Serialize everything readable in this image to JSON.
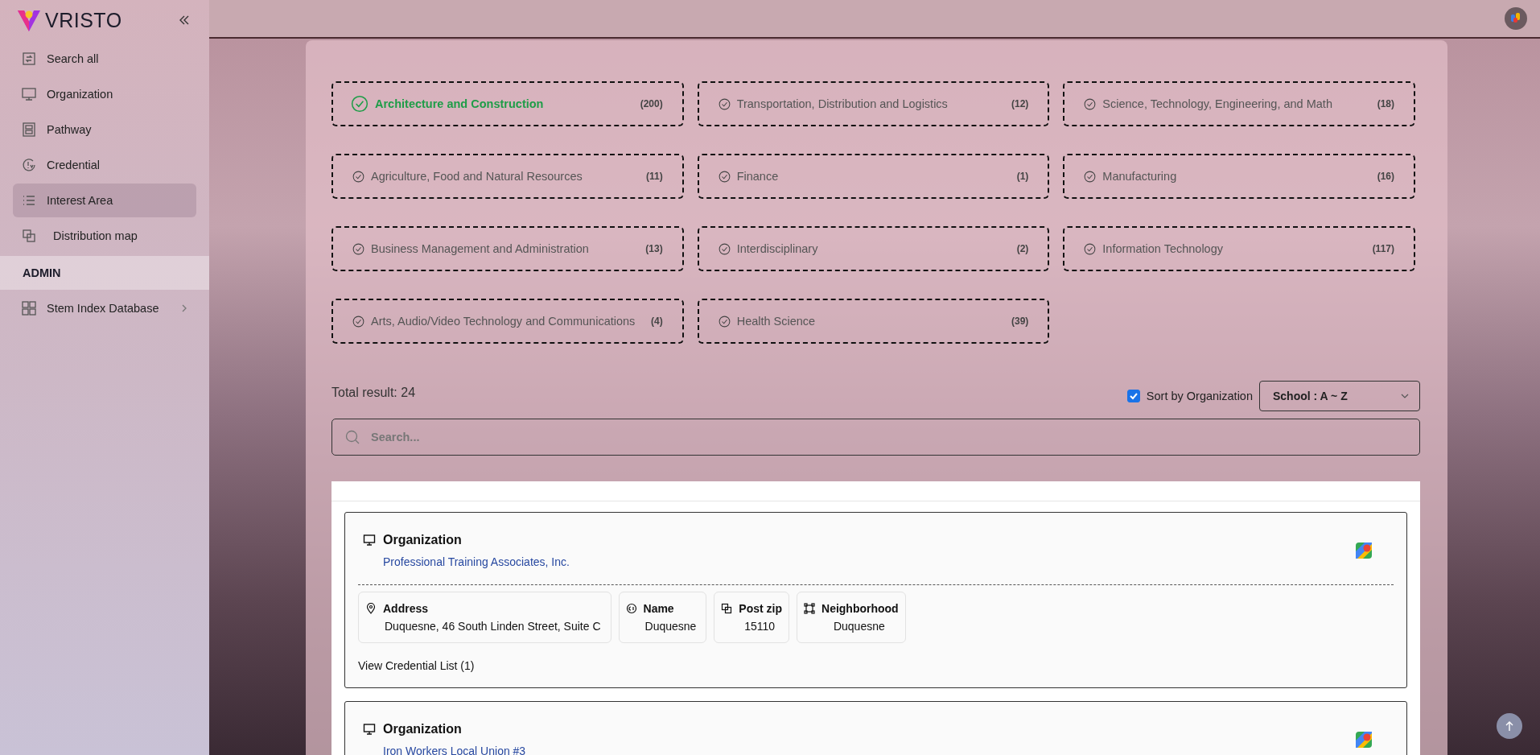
{
  "sidebar": {
    "brand": "VRISTO",
    "items": [
      {
        "label": "Search all",
        "kind": "search",
        "selected": false
      },
      {
        "label": "Organization",
        "kind": "monitor",
        "selected": false
      },
      {
        "label": "Pathway",
        "kind": "pathway",
        "selected": false
      },
      {
        "label": "Credential",
        "kind": "credential",
        "selected": false
      },
      {
        "label": "Interest Area",
        "kind": "list",
        "selected": true
      },
      {
        "label": "Distribution map",
        "kind": "map",
        "selected": false
      }
    ],
    "admin_heading": "ADMIN",
    "admin_items": [
      {
        "label": "Stem Index Database",
        "kind": "grid",
        "expanded": false
      }
    ]
  },
  "interest_areas": [
    {
      "label": "Architecture and Construction",
      "count": "(200)",
      "selected": true
    },
    {
      "label": "Transportation, Distribution and Logistics",
      "count": "(12)",
      "selected": false
    },
    {
      "label": "Science, Technology, Engineering, and Math",
      "count": "(18)",
      "selected": false
    },
    {
      "label": "Agriculture, Food and Natural Resources",
      "count": "(11)",
      "selected": false
    },
    {
      "label": "Finance",
      "count": "(1)",
      "selected": false
    },
    {
      "label": "Manufacturing",
      "count": "(16)",
      "selected": false
    },
    {
      "label": "Business Management and Administration",
      "count": "(13)",
      "selected": false
    },
    {
      "label": "Interdisciplinary",
      "count": "(2)",
      "selected": false
    },
    {
      "label": "Information Technology",
      "count": "(117)",
      "selected": false
    },
    {
      "label": "Arts, Audio/Video Technology and Communications",
      "count": "(4)",
      "selected": false
    },
    {
      "label": "Health Science",
      "count": "(39)",
      "selected": false
    }
  ],
  "total_result": "Total result: 24",
  "sort": {
    "label": "Sort by Organization",
    "checked": true,
    "select_value": "School : A ~ Z"
  },
  "search": {
    "placeholder": "Search..."
  },
  "results": [
    {
      "title": "Organization",
      "link": "Professional Training Associates, Inc.",
      "fields": [
        {
          "kind": "address",
          "label": "Address",
          "value": "Duquesne, 46 South Linden Street, Suite C"
        },
        {
          "kind": "name",
          "label": "Name",
          "value": "Duquesne"
        },
        {
          "kind": "zip",
          "label": "Post zip",
          "value": "15110"
        },
        {
          "kind": "neighborhood",
          "label": "Neighborhood",
          "value": "Duquesne"
        }
      ],
      "credential_link": "View Credential List (1)"
    },
    {
      "title": "Organization",
      "link": "Iron Workers Local Union #3"
    }
  ]
}
